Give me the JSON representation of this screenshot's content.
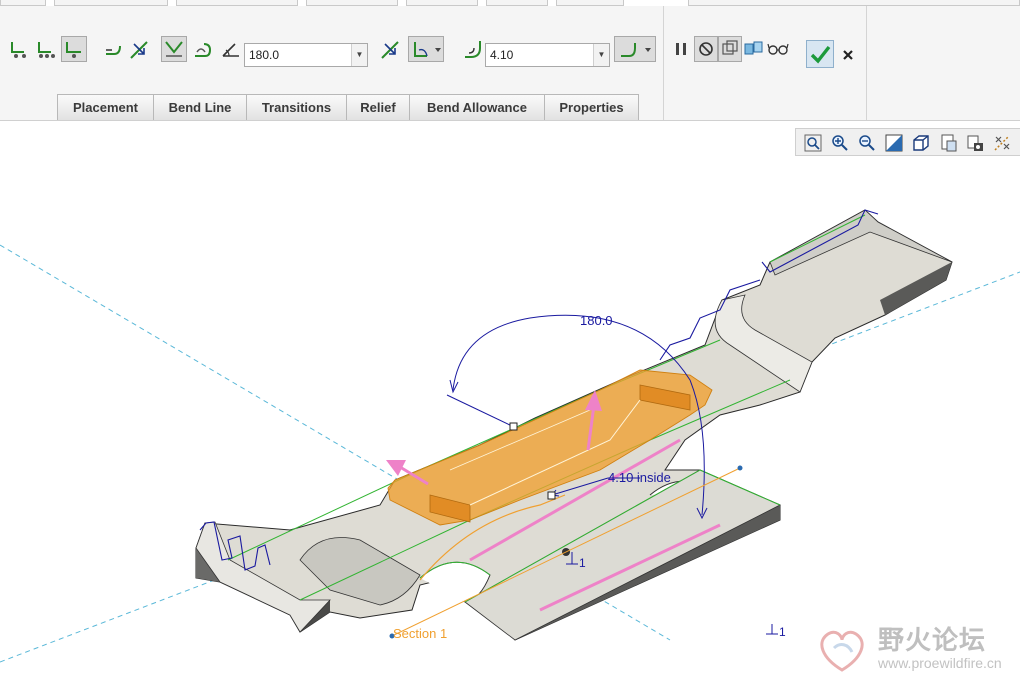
{
  "dashboard": {
    "angle_value": "180.0",
    "radius_value": "4.10",
    "tabs": [
      "Placement",
      "Bend Line",
      "Transitions",
      "Relief",
      "Bend Allowance",
      "Properties"
    ],
    "icons": {
      "bend_edge_1": "bend-from-edge-icon",
      "bend_edge_2": "bend-from-edge-alt-icon",
      "bend_edge_3": "bend-edge-selected-icon",
      "bend_direction": "bend-direction-icon",
      "flip_side": "flip-side-icon",
      "bend_type_rolled": "rolled-bend-icon",
      "bend_type_angle": "angle-bend-icon",
      "angle": "angle-icon",
      "flip_angle": "flip-angle-icon",
      "measure_option": "measure-option-icon",
      "radius": "radius-icon",
      "radius_side": "radius-side-icon",
      "pause": "pause-icon",
      "no_preview": "no-preview-icon",
      "preview_geometry": "preview-geometry-icon",
      "verify": "verify-icon",
      "glasses": "glasses-icon",
      "ok": "checkmark-icon",
      "cancel": "close-icon"
    }
  },
  "view_toolbar": {
    "icons": [
      "zoom-fit-icon",
      "zoom-in-icon",
      "zoom-out-icon",
      "repaint-icon",
      "display-style-icon",
      "saved-views-icon",
      "layers-icon",
      "datum-display-icon"
    ]
  },
  "model": {
    "angle_label": "180.0",
    "radius_label": "4.10 inside",
    "section_label": "Section 1",
    "datum_label_1": "1",
    "datum_label_2": "1"
  },
  "watermark": {
    "chinese": "野火论坛",
    "url": "www.proewildfire.cn"
  },
  "colors": {
    "bend_orange": "#f0a030",
    "dimension_blue": "#1a1aa0",
    "arrow_pink": "#ee82c8",
    "datum_cyan": "#5ab8d8",
    "edge_green": "#32b432",
    "part_gray": "#dcdcd4"
  }
}
